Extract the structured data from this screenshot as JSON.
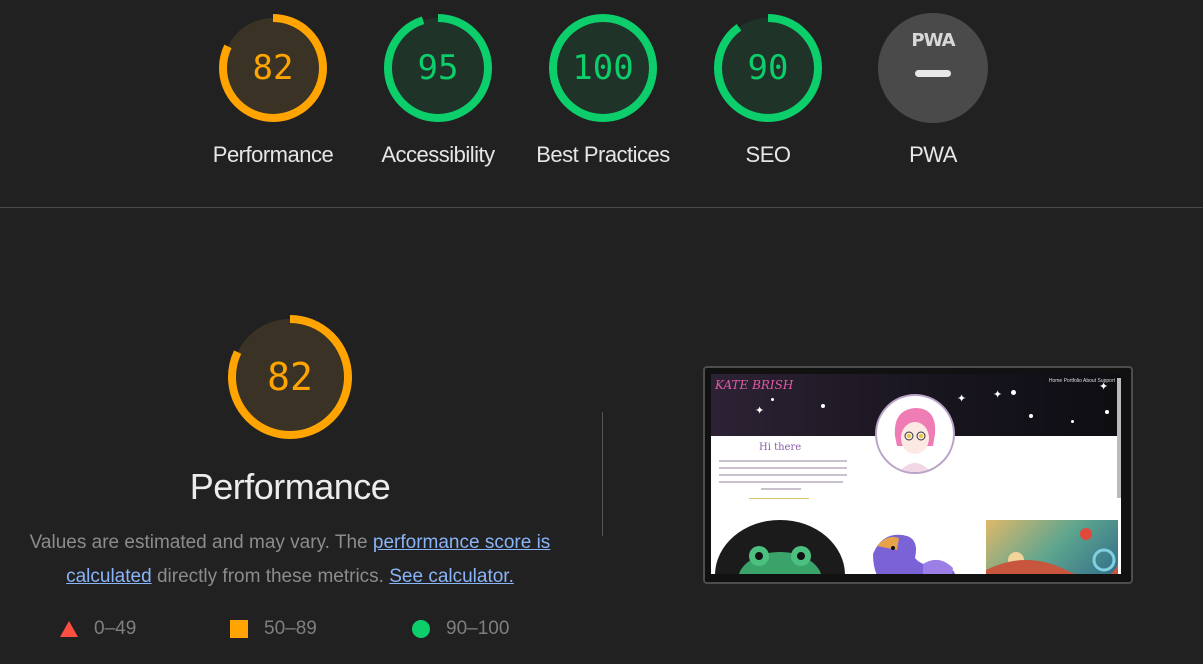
{
  "colors": {
    "background": "#212121",
    "fail": "#ff4e42",
    "average": "#ffa400",
    "pass": "#0cce6b",
    "link": "#8ab4f8"
  },
  "gauges": [
    {
      "score": "82",
      "label": "Performance",
      "value": 82,
      "color": "#ffa400"
    },
    {
      "score": "95",
      "label": "Accessibility",
      "value": 95,
      "color": "#0cce6b"
    },
    {
      "score": "100",
      "label": "Best Practices",
      "value": 100,
      "color": "#0cce6b"
    },
    {
      "score": "90",
      "label": "SEO",
      "value": 90,
      "color": "#0cce6b"
    }
  ],
  "pwa": {
    "badge_text": "PWA",
    "label": "PWA"
  },
  "performance_section": {
    "score": "82",
    "value": 82,
    "title": "Performance",
    "desc_prefix": "Values are estimated and may vary. The ",
    "link_score": "performance score is calculated",
    "desc_middle": " directly from these metrics. ",
    "link_calc": "See calculator."
  },
  "legend": [
    {
      "shape": "triangle",
      "range": "0–49"
    },
    {
      "shape": "square",
      "range": "50–89"
    },
    {
      "shape": "circle",
      "range": "90–100"
    }
  ],
  "screenshot": {
    "logo": "KATE BRISH",
    "nav": "Home  Portfolio  About  Support",
    "greeting": "Hi there"
  }
}
